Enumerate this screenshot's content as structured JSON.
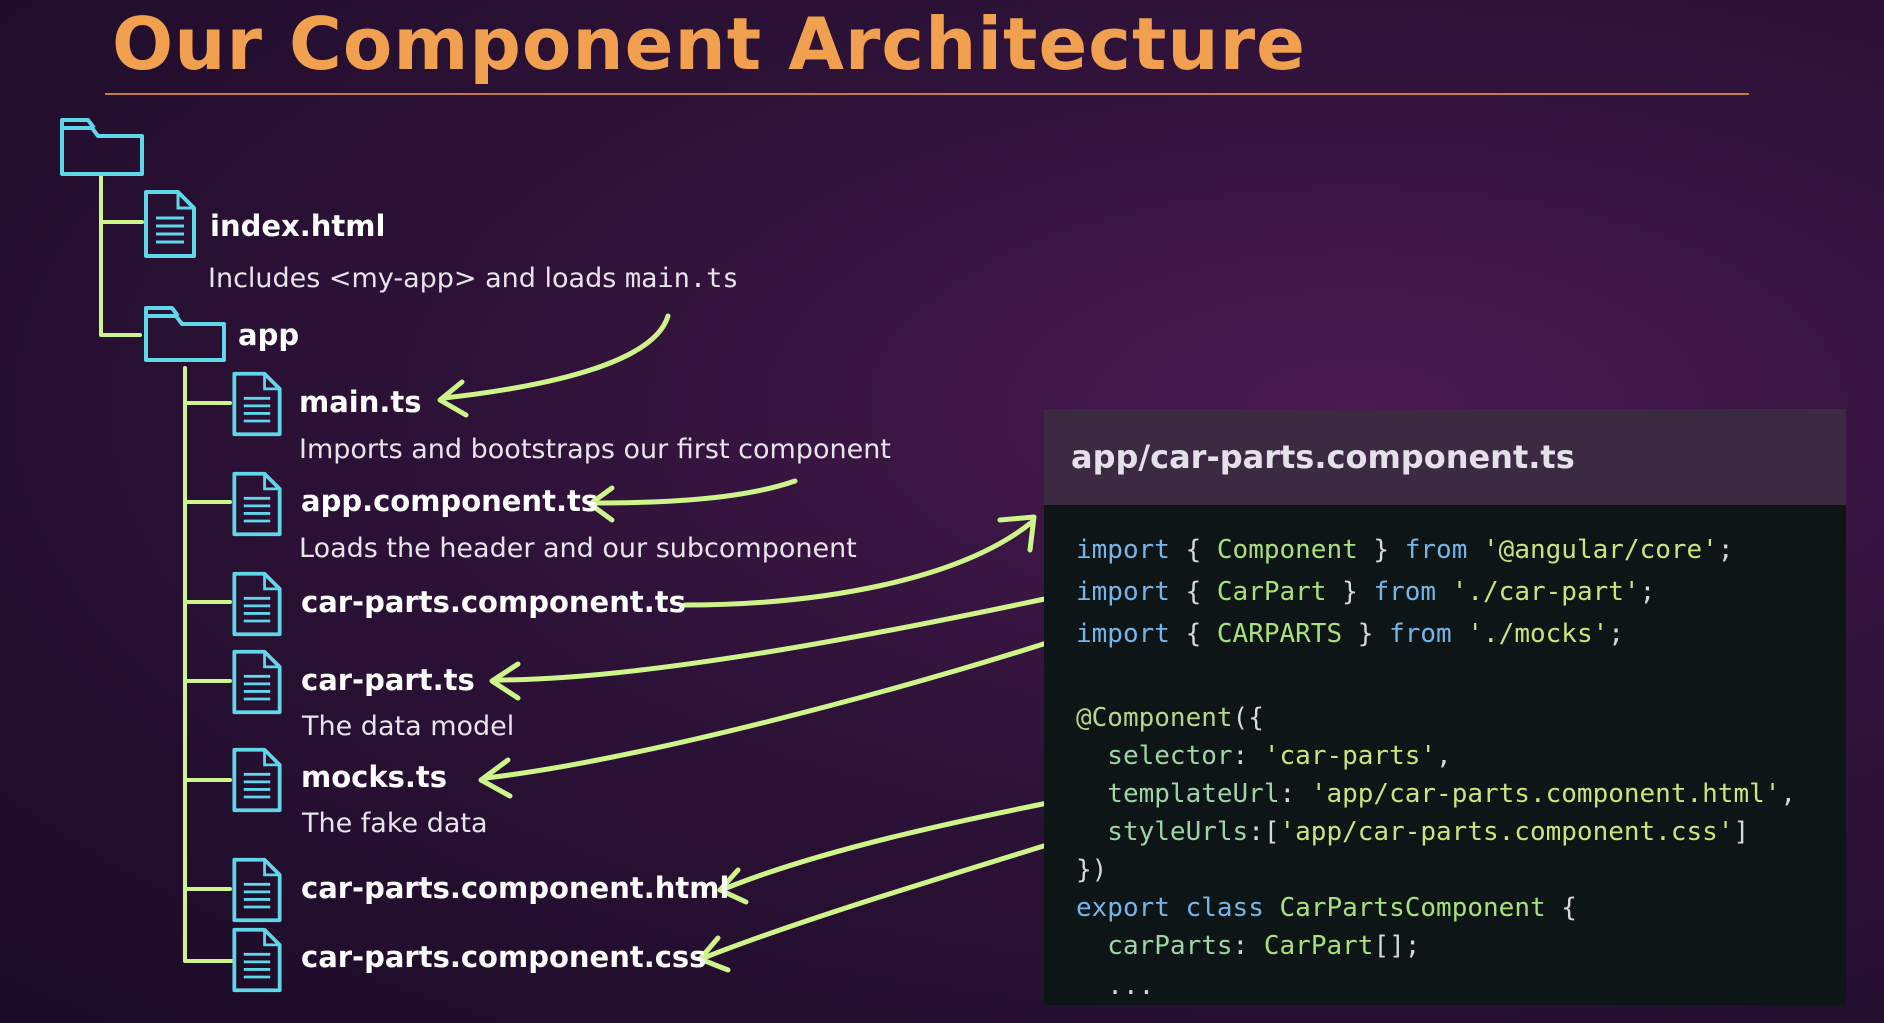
{
  "title": "Our Component Architecture",
  "tree": {
    "index_html": {
      "name": "index.html",
      "desc_prefix": "Includes <my-app> and loads ",
      "desc_code": "main.ts"
    },
    "app_folder": {
      "name": "app"
    },
    "files": [
      {
        "name": "main.ts",
        "desc": "Imports and bootstraps our first component"
      },
      {
        "name": "app.component.ts",
        "desc": "Loads the header and our subcomponent"
      },
      {
        "name": "car-parts.component.ts",
        "desc": ""
      },
      {
        "name": "car-part.ts",
        "desc": "The data model"
      },
      {
        "name": "mocks.ts",
        "desc": "The fake data"
      },
      {
        "name": "car-parts.component.html",
        "desc": ""
      },
      {
        "name": "car-parts.component.css",
        "desc": ""
      }
    ]
  },
  "code_panel": {
    "filename": "app/car-parts.component.ts",
    "lines": [
      {
        "tokens": [
          {
            "t": "import",
            "c": "kw"
          },
          {
            "t": " { ",
            "c": ""
          },
          {
            "t": "Component",
            "c": "cl"
          },
          {
            "t": " } ",
            "c": ""
          },
          {
            "t": "from",
            "c": "kw"
          },
          {
            "t": " ",
            "c": ""
          },
          {
            "t": "'@angular/core'",
            "c": "st"
          },
          {
            "t": ";",
            "c": ""
          }
        ]
      },
      {
        "tokens": [
          {
            "t": "import",
            "c": "kw"
          },
          {
            "t": " { ",
            "c": ""
          },
          {
            "t": "CarPart",
            "c": "cl"
          },
          {
            "t": " } ",
            "c": ""
          },
          {
            "t": "from",
            "c": "kw"
          },
          {
            "t": " ",
            "c": ""
          },
          {
            "t": "'./car-part'",
            "c": "st"
          },
          {
            "t": ";",
            "c": ""
          }
        ]
      },
      {
        "tokens": [
          {
            "t": "import",
            "c": "kw"
          },
          {
            "t": " { ",
            "c": ""
          },
          {
            "t": "CARPARTS",
            "c": "cl"
          },
          {
            "t": " } ",
            "c": ""
          },
          {
            "t": "from",
            "c": "kw"
          },
          {
            "t": " ",
            "c": ""
          },
          {
            "t": "'./mocks'",
            "c": "st"
          },
          {
            "t": ";",
            "c": ""
          }
        ]
      },
      {
        "tokens": []
      },
      {
        "tokens": [
          {
            "t": "@Component",
            "c": "dc"
          },
          {
            "t": "({",
            "c": ""
          }
        ]
      },
      {
        "tokens": [
          {
            "t": "  selector",
            "c": "pr"
          },
          {
            "t": ": ",
            "c": ""
          },
          {
            "t": "'car-parts'",
            "c": "st"
          },
          {
            "t": ",",
            "c": ""
          }
        ]
      },
      {
        "tokens": [
          {
            "t": "  templateUrl",
            "c": "pr"
          },
          {
            "t": ": ",
            "c": ""
          },
          {
            "t": "'app/car-parts.component.html'",
            "c": "st"
          },
          {
            "t": ",",
            "c": ""
          }
        ]
      },
      {
        "tokens": [
          {
            "t": "  styleUrls",
            "c": "pr"
          },
          {
            "t": ":[",
            "c": ""
          },
          {
            "t": "'app/car-parts.component.css'",
            "c": "st"
          },
          {
            "t": "]",
            "c": ""
          }
        ]
      },
      {
        "tokens": [
          {
            "t": "})",
            "c": ""
          }
        ]
      },
      {
        "tokens": [
          {
            "t": "export",
            "c": "kw"
          },
          {
            "t": " ",
            "c": ""
          },
          {
            "t": "class",
            "c": "kw"
          },
          {
            "t": " ",
            "c": ""
          },
          {
            "t": "CarPartsComponent",
            "c": "cl"
          },
          {
            "t": " {",
            "c": ""
          }
        ]
      },
      {
        "tokens": [
          {
            "t": "  carParts",
            "c": "pr"
          },
          {
            "t": ": ",
            "c": ""
          },
          {
            "t": "CarPart",
            "c": "cl"
          },
          {
            "t": "[];",
            "c": ""
          }
        ]
      },
      {
        "tokens": [
          {
            "t": "  ...",
            "c": ""
          }
        ]
      }
    ]
  },
  "colors": {
    "title": "#f0a04f",
    "arrow": "#cff58a",
    "icon": "#5fd7e8",
    "panel_bg": "#0d1517",
    "panel_header_bg": "#3b2a41"
  },
  "icons": {
    "folder": "folder-icon",
    "file": "file-icon"
  }
}
